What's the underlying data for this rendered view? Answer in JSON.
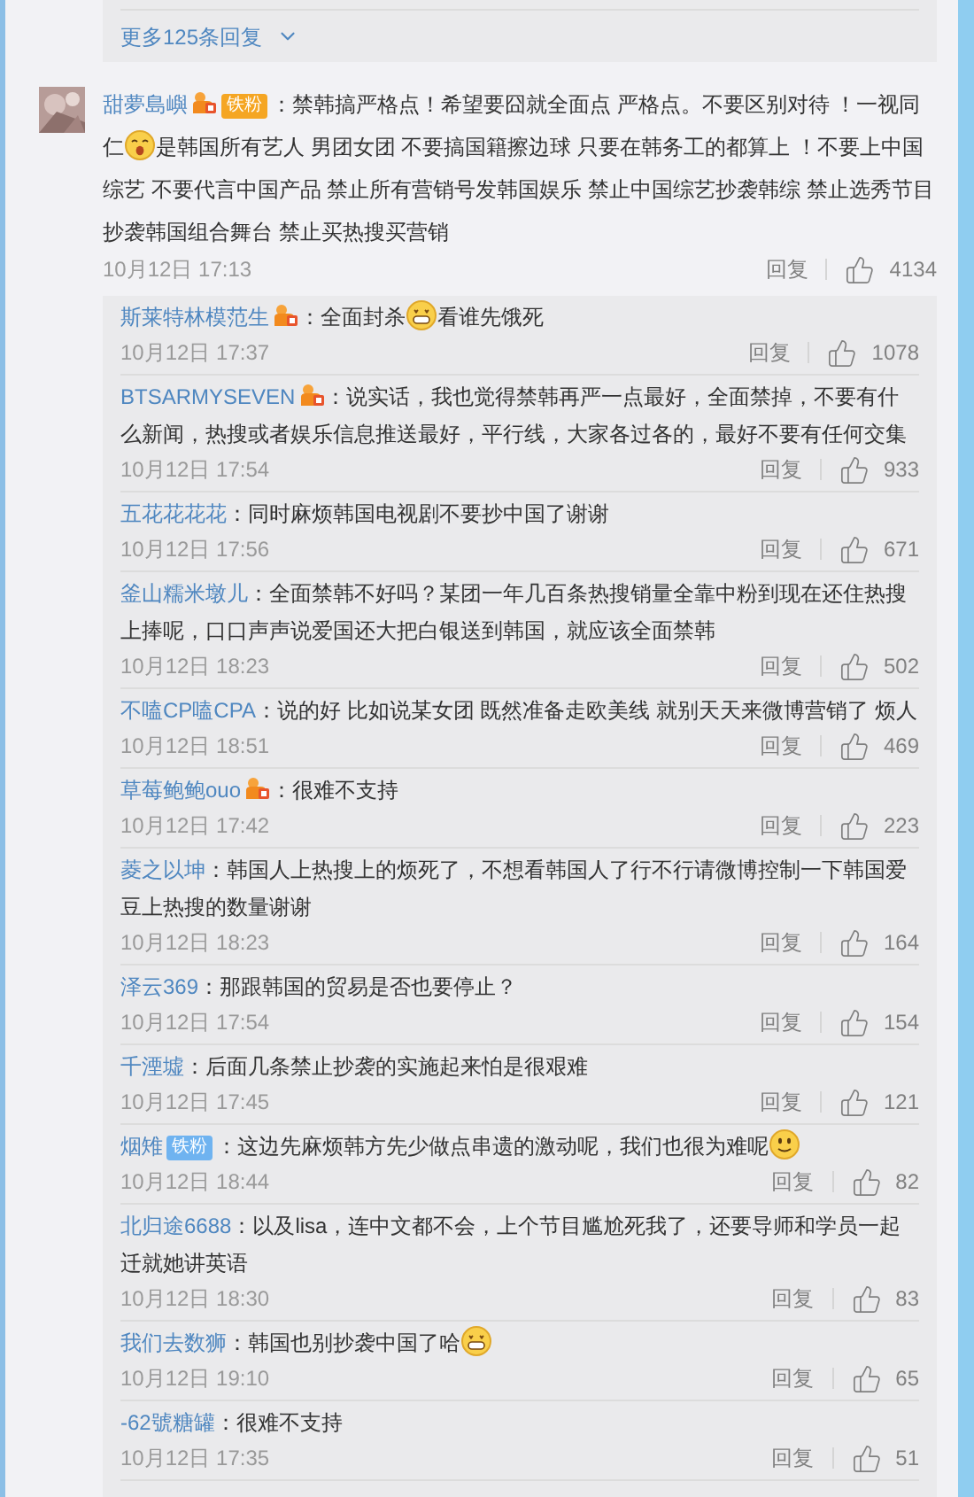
{
  "more_replies": {
    "label": "更多125条回复"
  },
  "comment": {
    "author": "甜夢島嶼",
    "badges": [
      {
        "kind": "vip"
      },
      {
        "kind": "fan",
        "label": "铁粉",
        "color": "#f5a623"
      }
    ],
    "parts": [
      {
        "kind": "text",
        "text": "：禁韩搞严格点！希望要囧就全面点 严格点。不要区别对待 ！一视同仁"
      },
      {
        "kind": "surprised"
      },
      {
        "kind": "text",
        "text": "是韩国所有艺人 男团女团 不要搞国籍擦边球 只要在韩务工的都算上 ！不要上中国综艺 不要代言中国产品 禁止所有营销号发韩国娱乐 禁止中国综艺抄袭韩综 禁止选秀节目抄袭韩国组合舞台 禁止买热搜买营销"
      }
    ],
    "time": "10月12日 17:13",
    "reply": "回复",
    "likes": "4134"
  },
  "replies": [
    {
      "author": "斯莱特林模范生",
      "badges": [
        {
          "kind": "vip"
        }
      ],
      "parts": [
        {
          "kind": "text",
          "text": "：全面封杀"
        },
        {
          "kind": "grin"
        },
        {
          "kind": "text",
          "text": "看谁先饿死"
        }
      ],
      "time": "10月12日 17:37",
      "reply": "回复",
      "likes": "1078"
    },
    {
      "author": "BTSARMYSEVEN",
      "badges": [
        {
          "kind": "vip"
        }
      ],
      "parts": [
        {
          "kind": "text",
          "text": "：说实话，我也觉得禁韩再严一点最好，全面禁掉，不要有什么新闻，热搜或者娱乐信息推送最好，平行线，大家各过各的，最好不要有任何交集"
        }
      ],
      "time": "10月12日 17:54",
      "reply": "回复",
      "likes": "933"
    },
    {
      "author": "五花花花花",
      "parts": [
        {
          "kind": "text",
          "text": "：同时麻烦韩国电视剧不要抄中国了谢谢"
        }
      ],
      "time": "10月12日 17:56",
      "reply": "回复",
      "likes": "671"
    },
    {
      "author": "釜山糯米墩儿",
      "parts": [
        {
          "kind": "text",
          "text": "：全面禁韩不好吗？某团一年几百条热搜销量全靠中粉到现在还住热搜上捧呢，口口声声说爱国还大把白银送到韩国，就应该全面禁韩"
        }
      ],
      "time": "10月12日 18:23",
      "reply": "回复",
      "likes": "502"
    },
    {
      "author": "不嗑CP嗑CPA",
      "parts": [
        {
          "kind": "text",
          "text": "：说的好 比如说某女团 既然准备走欧美线 就别天天来微博营销了 烦人"
        }
      ],
      "time": "10月12日 18:51",
      "reply": "回复",
      "likes": "469"
    },
    {
      "author": "草莓鲍鲍ouo",
      "badges": [
        {
          "kind": "vip"
        }
      ],
      "parts": [
        {
          "kind": "text",
          "text": "：很难不支持"
        }
      ],
      "time": "10月12日 17:42",
      "reply": "回复",
      "likes": "223"
    },
    {
      "author": "菱之以坤",
      "parts": [
        {
          "kind": "text",
          "text": "：韩国人上热搜上的烦死了，不想看韩国人了行不行请微博控制一下韩国爱豆上热搜的数量谢谢"
        }
      ],
      "time": "10月12日 18:23",
      "reply": "回复",
      "likes": "164"
    },
    {
      "author": "泽云369",
      "parts": [
        {
          "kind": "text",
          "text": "：那跟韩国的贸易是否也要停止？"
        }
      ],
      "time": "10月12日 17:54",
      "reply": "回复",
      "likes": "154"
    },
    {
      "author": "千湮墟",
      "parts": [
        {
          "kind": "text",
          "text": "：后面几条禁止抄袭的实施起来怕是很艰难"
        }
      ],
      "time": "10月12日 17:45",
      "reply": "回复",
      "likes": "121"
    },
    {
      "author": "烟雉",
      "badges": [
        {
          "kind": "fan",
          "label": "铁粉",
          "color": "#6fb3f0"
        }
      ],
      "parts": [
        {
          "kind": "text",
          "text": "：这边先麻烦韩方先少做点串遗的激动呢，我们也很为难呢"
        },
        {
          "kind": "smile"
        }
      ],
      "time": "10月12日 18:44",
      "reply": "回复",
      "likes": "82"
    },
    {
      "author": "北归途6688",
      "parts": [
        {
          "kind": "text",
          "text": "：以及lisa，连中文都不会，上个节目尴尬死我了，还要导师和学员一起迁就她讲英语"
        }
      ],
      "time": "10月12日 18:30",
      "reply": "回复",
      "likes": "83"
    },
    {
      "author": "我们去数狮",
      "parts": [
        {
          "kind": "text",
          "text": "：韩国也别抄袭中国了哈"
        },
        {
          "kind": "grin"
        }
      ],
      "time": "10月12日 19:10",
      "reply": "回复",
      "likes": "65"
    },
    {
      "author": "-62號糖罐",
      "parts": [
        {
          "kind": "text",
          "text": "：很难不支持"
        }
      ],
      "time": "10月12日 17:35",
      "reply": "回复",
      "likes": "51"
    }
  ]
}
